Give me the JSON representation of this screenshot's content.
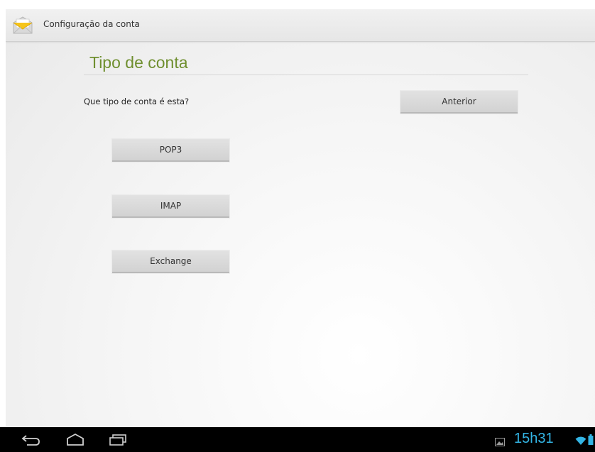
{
  "actionbar": {
    "title": "Configuração da conta",
    "icon": "email-envelope-icon"
  },
  "page": {
    "heading": "Tipo de conta",
    "question": "Que tipo de conta é esta?"
  },
  "buttons": {
    "previous_label": "Anterior",
    "pop3_label": "POP3",
    "imap_label": "IMAP",
    "exchange_label": "Exchange"
  },
  "navbar": {
    "back_icon": "back-icon",
    "home_icon": "home-icon",
    "recent_icon": "recent-apps-icon"
  },
  "status": {
    "time": "15h31",
    "notification_icon": "image-notification-icon",
    "wifi_icon": "wifi-icon",
    "battery_icon": "battery-icon"
  },
  "colors": {
    "heading": "#6f8f2f",
    "clock": "#33b5e5",
    "navbar": "#000000"
  }
}
